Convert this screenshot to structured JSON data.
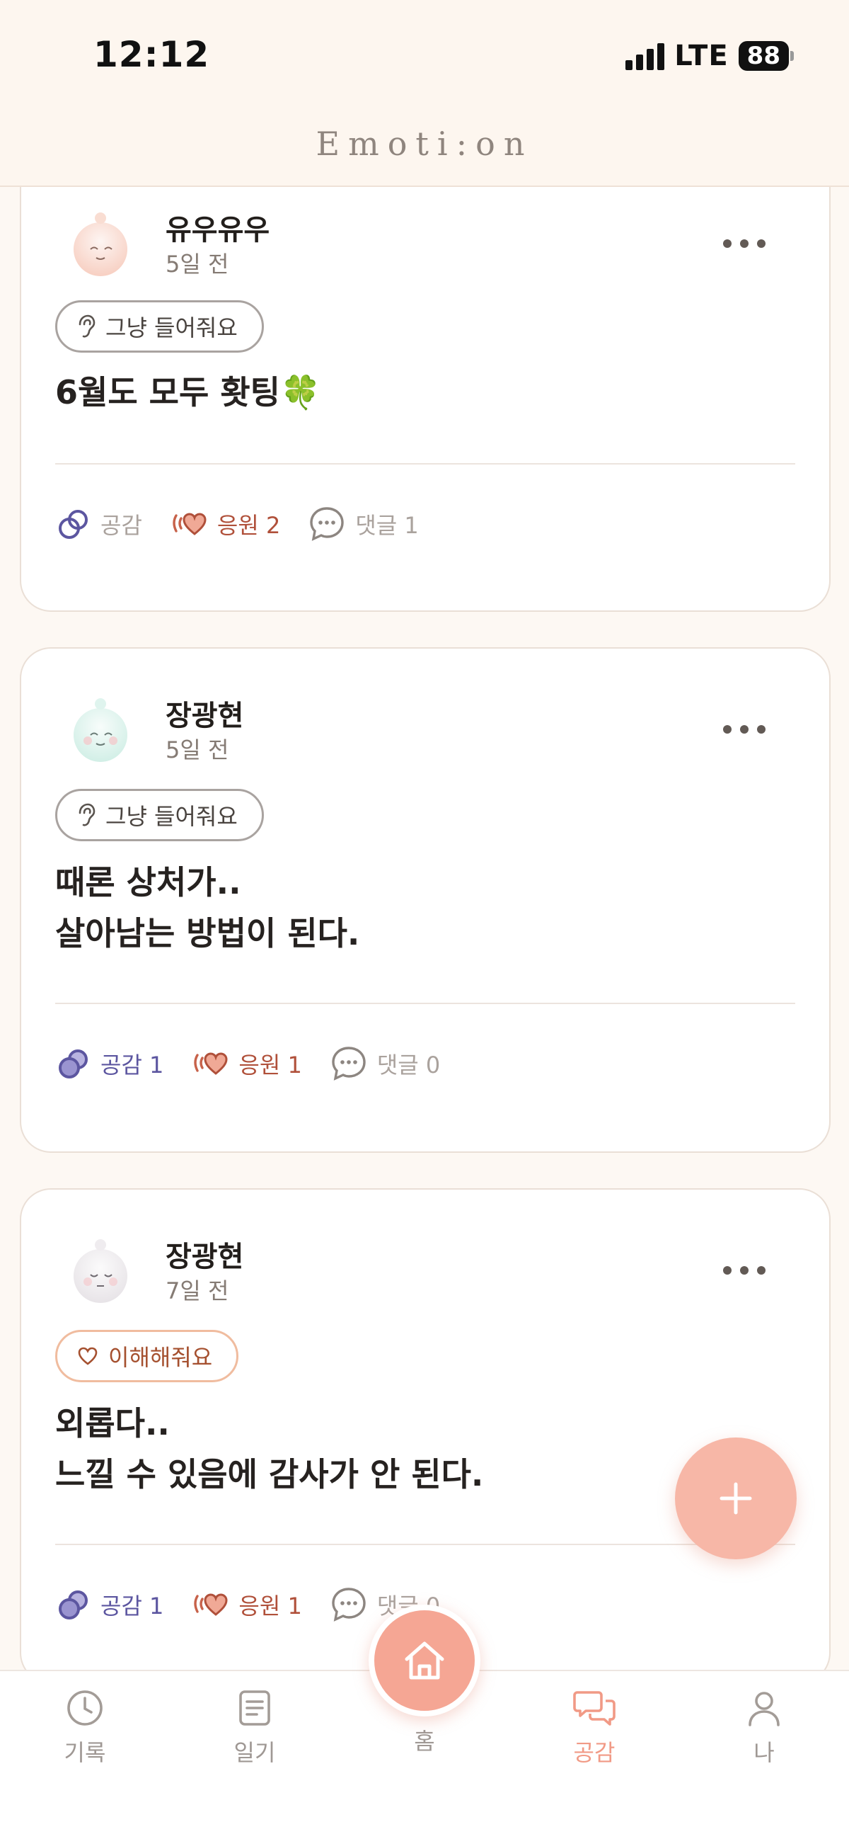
{
  "status_bar": {
    "time": "12:12",
    "network": "LTE",
    "battery": "88"
  },
  "header": {
    "app_title": "Emoti:on"
  },
  "posts": [
    {
      "author": "유우유우",
      "time_ago": "5일 전",
      "tag": "그냥 들어줘요",
      "tag_icon": "ear-icon",
      "body": "6월도 모두 홧팅🍀",
      "empathy_label": "공감",
      "cheer_label": "응원 2",
      "comment_label": "댓글 1",
      "avatar_color": "#f7cdbf"
    },
    {
      "author": "장광현",
      "time_ago": "5일 전",
      "tag": "그냥 들어줘요",
      "tag_icon": "ear-icon",
      "body": "때론 상처가..\n살아남는 방법이 된다.",
      "empathy_label": "공감 1",
      "cheer_label": "응원 1",
      "comment_label": "댓글 0",
      "avatar_color": "#cfeee5"
    },
    {
      "author": "장광현",
      "time_ago": "7일 전",
      "tag": "이해해줘요",
      "tag_icon": "heart-icon",
      "body": "외롭다..\n느낄 수 있음에 감사가 안 된다.",
      "empathy_label": "공감 1",
      "cheer_label": "응원 1",
      "comment_label": "댓글 0",
      "avatar_color": "#e6e2e6"
    }
  ],
  "bottom_nav": {
    "items": [
      {
        "label": "기록",
        "icon": "clock-icon"
      },
      {
        "label": "일기",
        "icon": "diary-icon"
      },
      {
        "label": "홈",
        "icon": "home-icon"
      },
      {
        "label": "공감",
        "icon": "chat-bubbles-icon",
        "active": true
      },
      {
        "label": "나",
        "icon": "person-icon"
      }
    ]
  },
  "colors": {
    "accent": "#f5a694",
    "empathy": "#5c56a0",
    "cheer": "#b0503a",
    "background": "#fdf8f3"
  }
}
